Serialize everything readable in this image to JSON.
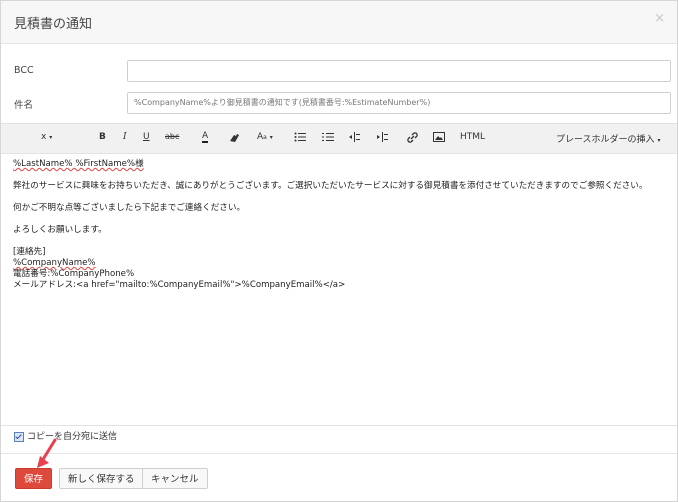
{
  "dialog": {
    "title": "見積書の通知"
  },
  "form": {
    "bcc_label": "BCC",
    "bcc_value": "",
    "subject_label": "件名",
    "subject_value": "%CompanyName%より御見積書の通知です(見積書番号:%EstimateNumber%)"
  },
  "toolbar": {
    "font_size": "x",
    "bold": "B",
    "italic": "I",
    "underline": "U",
    "strike": "abc",
    "font_color": "A",
    "font_case": "A",
    "html": "HTML",
    "placeholder_insert": "プレースホルダーの挿入"
  },
  "editor": {
    "line1": "%LastName% %FirstName%様",
    "line2": "弊社のサービスに興味をお持ちいただき、誠にありがとうございます。ご選択いただいたサービスに対する御見積書を添付させていただきますのでご参照ください。",
    "line3": "何かご不明な点等ございましたら下記までご連絡ください。",
    "line4": "よろしくお願いします。",
    "line5": "[連絡先]",
    "line6": "%CompanyName%",
    "line7": "電話番号:%CompanyPhone%",
    "line8": "メールアドレス:<a href=\"mailto:%CompanyEmail%\">%CompanyEmail%</a>"
  },
  "options": {
    "copy_label": "コピーを自分宛に送信",
    "copy_checked": true
  },
  "buttons": {
    "save": "保存",
    "save_new": "新しく保存する",
    "cancel": "キャンセル"
  },
  "colors": {
    "primary": "#dd4a3c",
    "annotation_arrow": "#e8404f"
  }
}
